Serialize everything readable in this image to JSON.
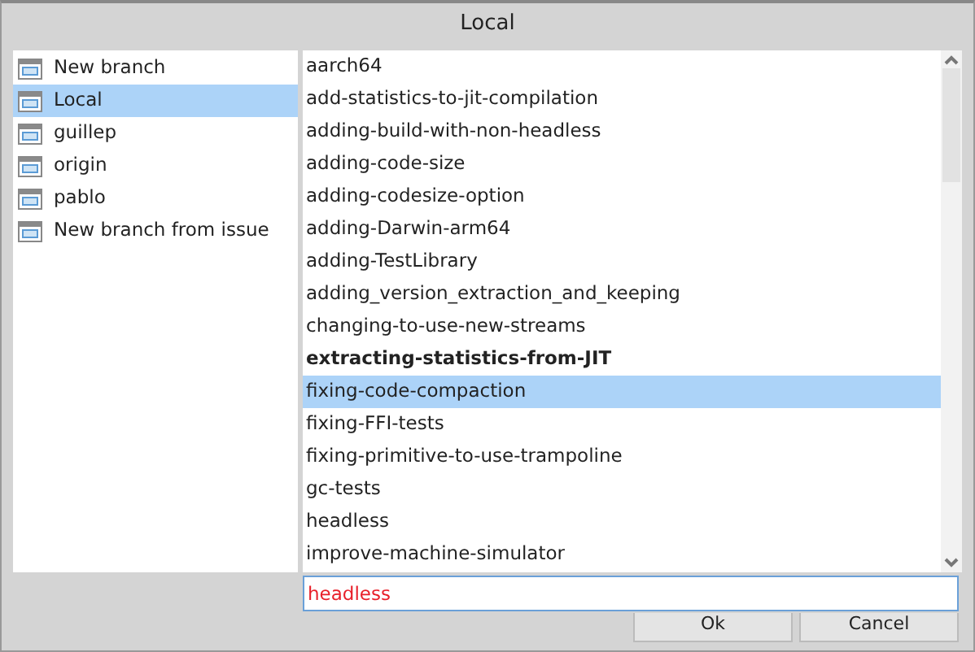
{
  "window": {
    "title": "Local"
  },
  "remotes": [
    {
      "label": "New branch",
      "selected": false
    },
    {
      "label": "Local",
      "selected": true
    },
    {
      "label": "guillep",
      "selected": false
    },
    {
      "label": "origin",
      "selected": false
    },
    {
      "label": "pablo",
      "selected": false
    },
    {
      "label": "New branch from issue",
      "selected": false
    }
  ],
  "branches": [
    {
      "label": "aarch64",
      "selected": false,
      "current": false
    },
    {
      "label": "add-statistics-to-jit-compilation",
      "selected": false,
      "current": false
    },
    {
      "label": "adding-build-with-non-headless",
      "selected": false,
      "current": false
    },
    {
      "label": "adding-code-size",
      "selected": false,
      "current": false
    },
    {
      "label": "adding-codesize-option",
      "selected": false,
      "current": false
    },
    {
      "label": "adding-Darwin-arm64",
      "selected": false,
      "current": false
    },
    {
      "label": "adding-TestLibrary",
      "selected": false,
      "current": false
    },
    {
      "label": "adding_version_extraction_and_keeping",
      "selected": false,
      "current": false
    },
    {
      "label": "changing-to-use-new-streams",
      "selected": false,
      "current": false
    },
    {
      "label": "extracting-statistics-from-JIT",
      "selected": false,
      "current": true
    },
    {
      "label": "fixing-code-compaction",
      "selected": true,
      "current": false
    },
    {
      "label": "fixing-FFI-tests",
      "selected": false,
      "current": false
    },
    {
      "label": "fixing-primitive-to-use-trampoline",
      "selected": false,
      "current": false
    },
    {
      "label": "gc-tests",
      "selected": false,
      "current": false
    },
    {
      "label": "headless",
      "selected": false,
      "current": false
    },
    {
      "label": "improve-machine-simulator",
      "selected": false,
      "current": false
    }
  ],
  "filter": {
    "value": "headless"
  },
  "buttons": [
    "Ok",
    "Cancel"
  ]
}
